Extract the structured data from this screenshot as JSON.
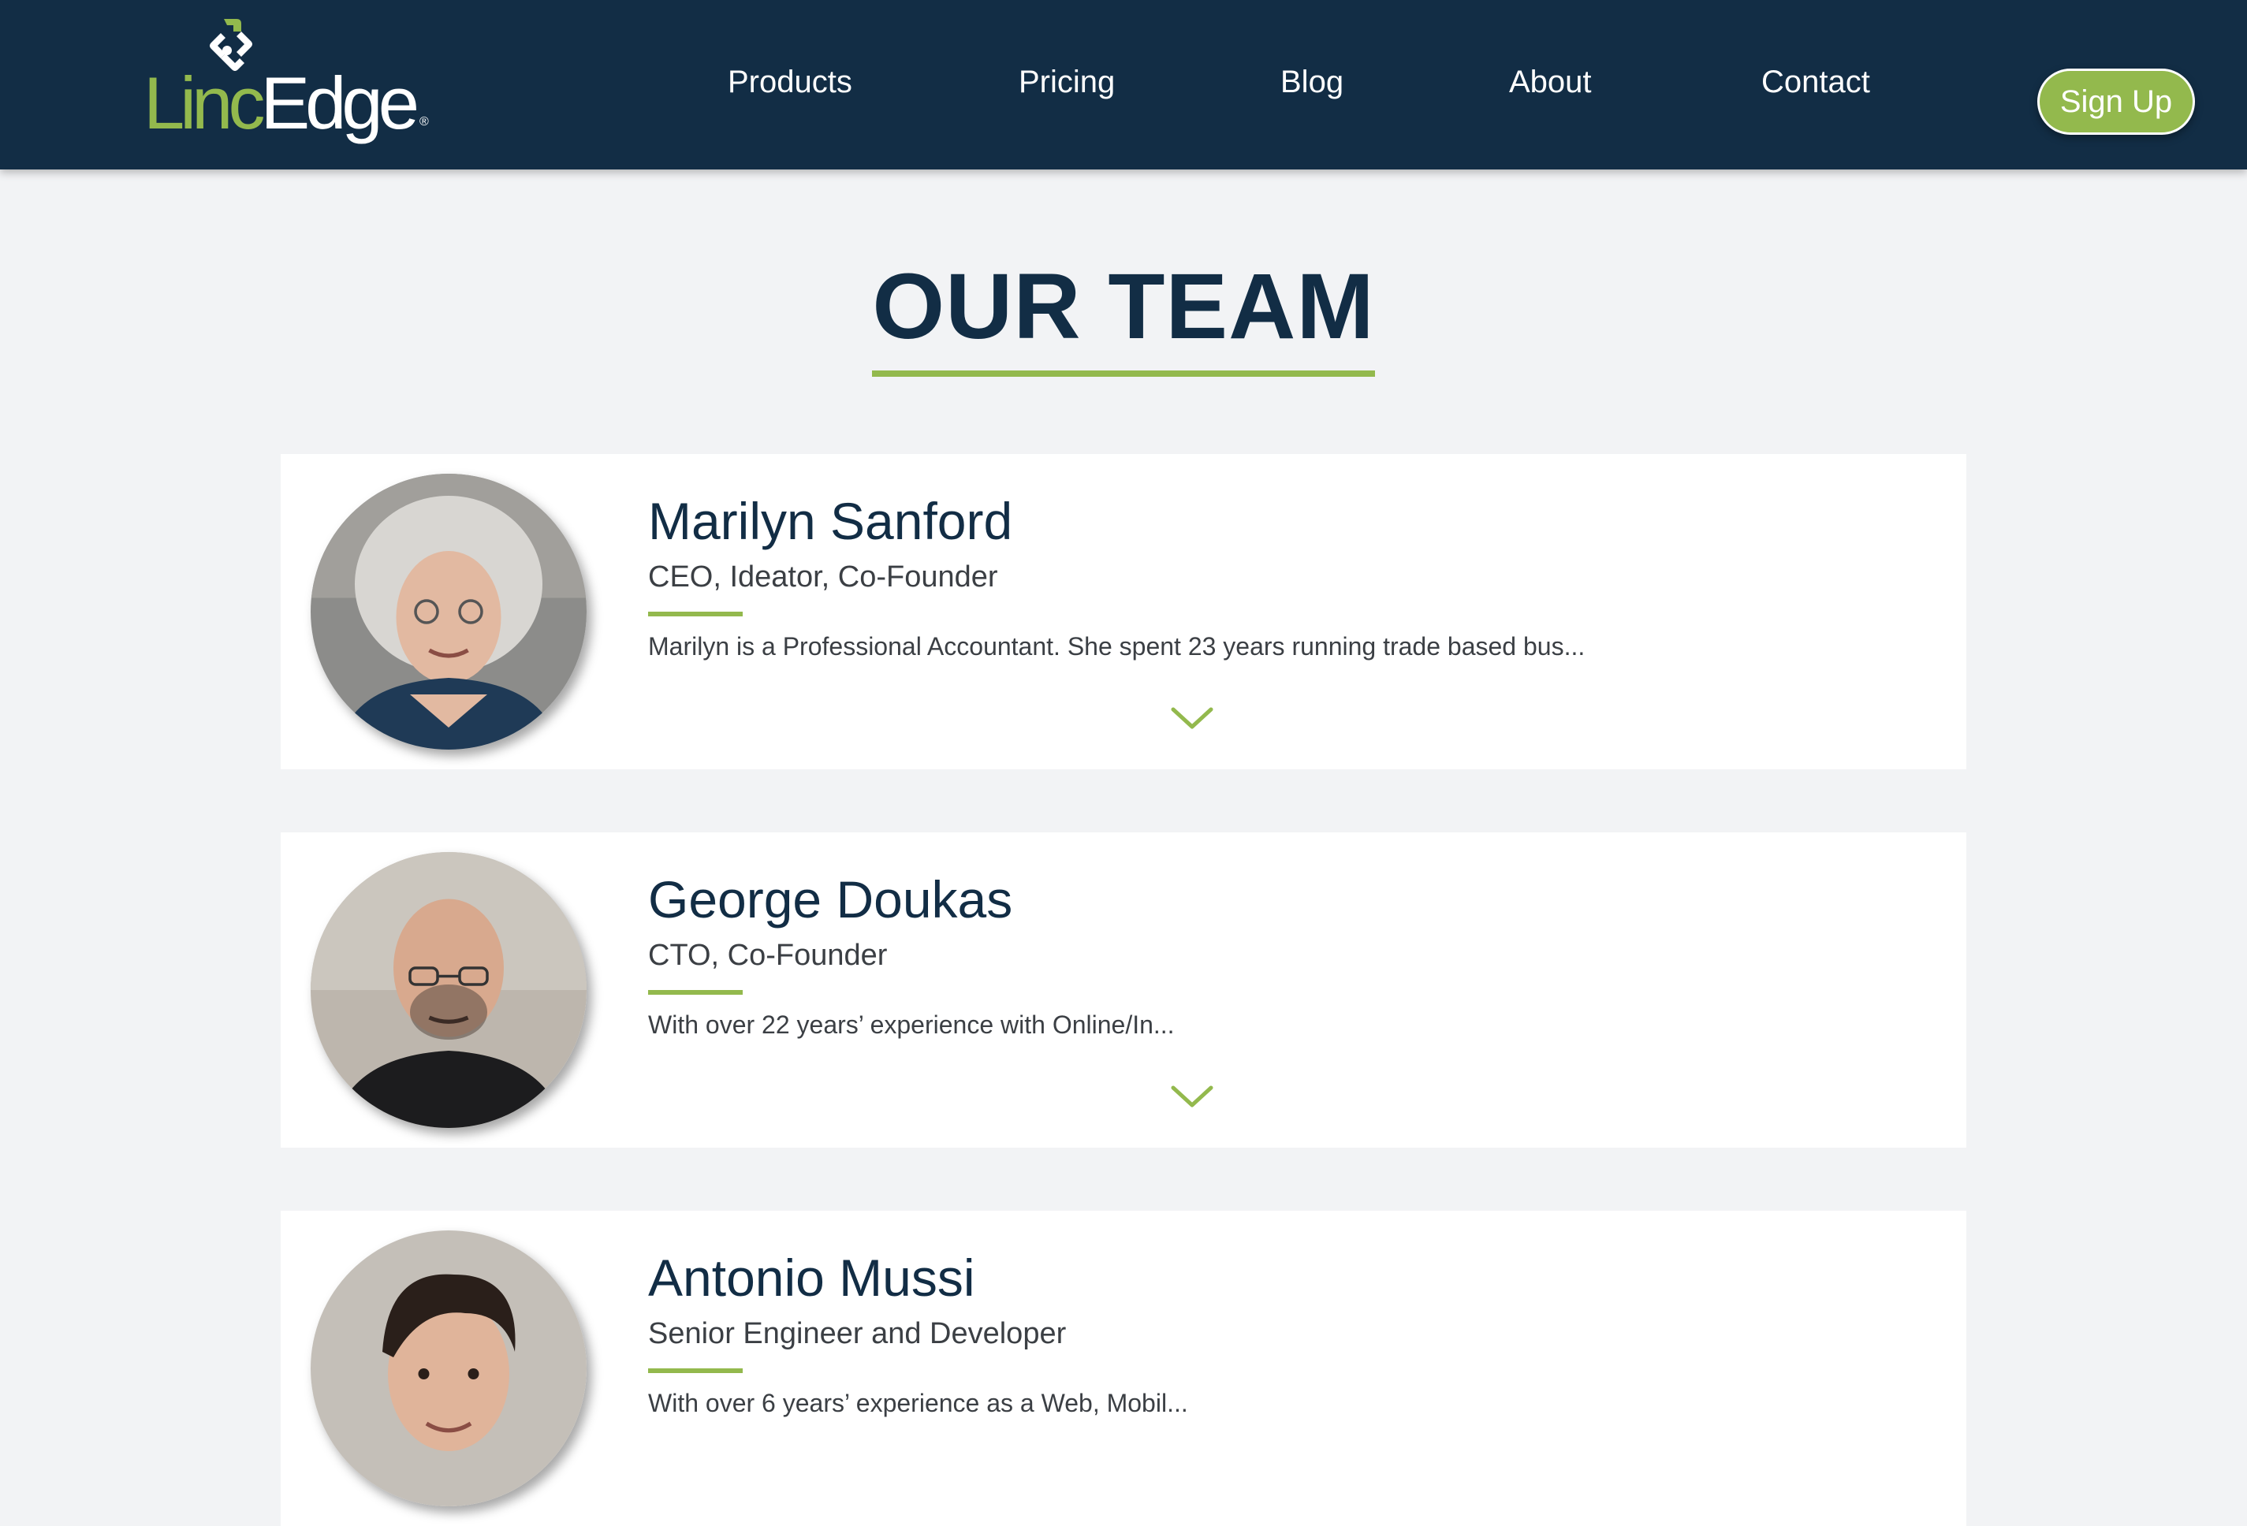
{
  "brand": {
    "logo_first": "Linc",
    "logo_second": "Edge",
    "logo_mark": "®",
    "accent_color": "#93b94d",
    "navy_color": "#122d45"
  },
  "nav": {
    "items": [
      "Products",
      "Pricing",
      "Blog",
      "About",
      "Contact"
    ],
    "signup_label": "Sign Up"
  },
  "section": {
    "title": "OUR TEAM"
  },
  "team": [
    {
      "name": "Marilyn Sanford",
      "role": "CEO, Ideator, Co-Founder",
      "bio": "Marilyn is a Professional Accountant. She spent 23 years running trade based bus...",
      "photo_icon": "person-photo"
    },
    {
      "name": "George Doukas",
      "role": "CTO, Co-Founder",
      "bio": "With over 22 years’ experience with Online/In...",
      "photo_icon": "person-photo"
    },
    {
      "name": "Antonio Mussi",
      "role": "Senior Engineer and Developer",
      "bio": "With over 6 years’ experience as a Web, Mobil...",
      "photo_icon": "person-photo"
    }
  ],
  "icons": {
    "expand": "chevron-down-icon"
  }
}
